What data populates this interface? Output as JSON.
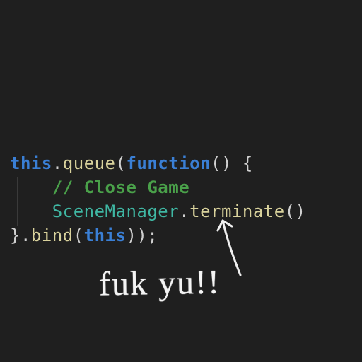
{
  "code": {
    "l1": {
      "this": "this",
      "dot1": ".",
      "queue": "queue",
      "open": "(",
      "func": "function",
      "paren": "()",
      "brace": " {"
    },
    "l2": {
      "indent": "    ",
      "comment": "// Close Game"
    },
    "l3": {
      "indent": "    ",
      "scene": "SceneManager",
      "dot": ".",
      "term": "terminate",
      "paren": "()"
    },
    "l4": {
      "cb": "}",
      "dot": ".",
      "bind": "bind",
      "open": "(",
      "this": "this",
      "close": "));"
    }
  },
  "annotation": {
    "text": "fuk yu!!"
  }
}
